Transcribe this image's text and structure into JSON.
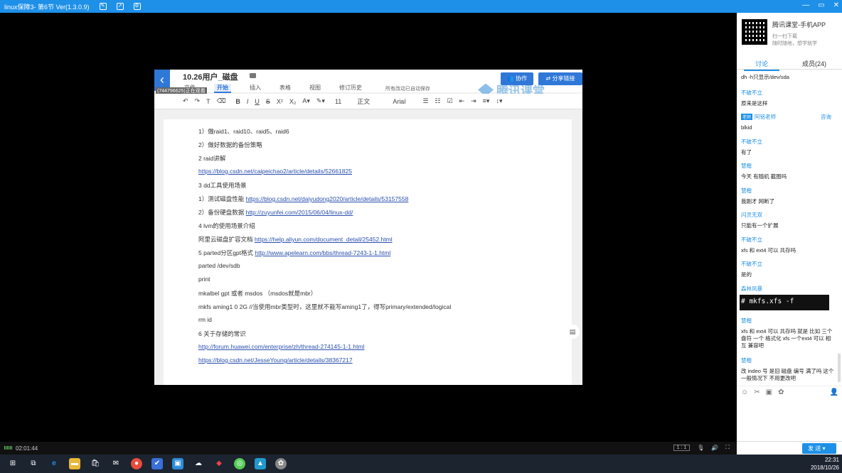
{
  "window": {
    "title": "linux保障3- 第6节 Ver(1.3.0.9)",
    "controls": [
      "—",
      "▭",
      "✕"
    ]
  },
  "doc": {
    "title": "10.26用户_磁盘",
    "menu": [
      "文件",
      "开始",
      "插入",
      "表格",
      "视图",
      "修订历史"
    ],
    "active_menu": "开始",
    "save_status": "所有改动已自动保存",
    "collab_label": "协作",
    "share_label": "分享链接",
    "watermark": "腾讯课堂",
    "user_id": "(744796625)正在观看",
    "toolbar": {
      "font_size": "11",
      "style": "正文",
      "font": "Arial"
    },
    "lines": [
      {
        "text": "1）做raid1、raid10、raid5、raid6",
        "link": ""
      },
      {
        "text": "2）做好数据的备份策略",
        "link": ""
      },
      {
        "text": "2 raid讲解",
        "link": ""
      },
      {
        "text": "",
        "link": "https://blog.csdn.net/caipeichao2/article/details/52661825"
      },
      {
        "text": "3 dd工具使用场景",
        "link": ""
      },
      {
        "text": "1）测试磁盘性能 ",
        "link": "https://blog.csdn.net/daiyudong2020/article/details/53157558"
      },
      {
        "text": "2）备份硬盘数据 ",
        "link": "http://zuyunfei.com/2015/06/04/linux-dd/"
      },
      {
        "text": "4 lvm的使用场景介绍",
        "link": ""
      },
      {
        "text": "阿里云磁盘扩容文档 ",
        "link": "https://help.aliyun.com/document_detail/25452.html"
      },
      {
        "text": "5 parted分区gpt格式  ",
        "link": "http://www.apelearn.com/bbs/thread-7243-1-1.html"
      },
      {
        "text": "parted /dev/sdb",
        "link": ""
      },
      {
        "text": "print",
        "link": ""
      },
      {
        "text": "mkalbel  gpt 或者 msdos （msdos就是mbr）",
        "link": ""
      },
      {
        "text": "mkfs aming1 0 2G  //当使用mbr类型时，这里就不能写aming1了，得写primary/extended/logical",
        "link": ""
      },
      {
        "text": "rm  id",
        "link": ""
      },
      {
        "text": "6 关于存储的常识",
        "link": ""
      },
      {
        "text": "",
        "link": "http://forum.huawei.com/enterprise/zh/thread-274145-1-1.html"
      },
      {
        "text": "",
        "link": "https://blog.csdn.net/JesseYoung/article/details/38367217"
      }
    ]
  },
  "player": {
    "elapsed": "02:01:44",
    "ratio": "1 : 1"
  },
  "sidebar": {
    "app_title": "腾讯课堂-手机APP",
    "app_sub1": "扫一扫下载",
    "app_sub2": "随时随地，想学就学",
    "tabs": [
      "讨论",
      "成员(24)"
    ],
    "messages": [
      {
        "name": "",
        "text": "dh -h只显示/dev/sda"
      },
      {
        "name": "不破不立",
        "text": "原来是这样"
      },
      {
        "name": "阿铭老师",
        "tag": "老师",
        "ask": "咨询",
        "text": "blkid"
      },
      {
        "name": "不破不立",
        "text": "有了"
      },
      {
        "name": "慧楷",
        "text": "今天 有随机 截图吗"
      },
      {
        "name": "慧楷",
        "text": "我刚才 网断了"
      },
      {
        "name": "闪灵无双",
        "text": "只能有一个扩展"
      },
      {
        "name": "不破不立",
        "text": "xfs 和 ext4 可以 共存吗"
      },
      {
        "name": "不破不立",
        "text": "是的"
      },
      {
        "name": "森林风暴",
        "text": ""
      },
      {
        "name": "慧楷",
        "text": "xfs 和 ext4 可以 共存吗 就是 比如 三个 盘符 一个 格式化 xfs 一个ext4 可以 相互 兼容吧"
      },
      {
        "name": "慧楷",
        "text": "改 indeo 号 是旧 磁盘 编号 满了吗 这个 一般情况下 不用更改吧"
      }
    ],
    "code_image": "# mkfs.xfs -f /dev/sdb1",
    "send_label": "发 送"
  },
  "taskbar": {
    "time": "22:31",
    "date": "2018/10/26"
  }
}
